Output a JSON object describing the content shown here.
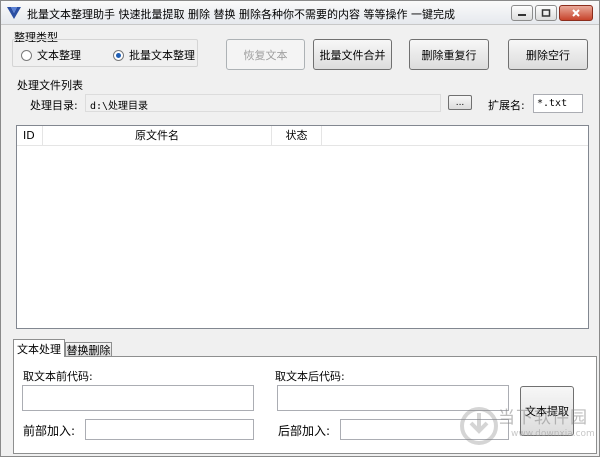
{
  "window": {
    "title": "批量文本整理助手   快速批量提取 删除 替换 删除各种你不需要的内容 等等操作 一键完成"
  },
  "organize_type": {
    "label": "整理类型",
    "options": [
      {
        "label": "文本整理",
        "selected": false
      },
      {
        "label": "批量文本整理",
        "selected": true
      }
    ]
  },
  "toolbar": {
    "restore_label": "恢复文本",
    "merge_label": "批量文件合并",
    "dedupe_label": "删除重复行",
    "delete_empty_label": "删除空行"
  },
  "file_list": {
    "group_label": "处理文件列表",
    "dir_label": "处理目录:",
    "dir_value": "d:\\处理目录",
    "browse_label": "...",
    "ext_label": "扩展名:",
    "ext_value": "*.txt",
    "columns": [
      "ID",
      "原文件名",
      "状态"
    ],
    "rows": []
  },
  "tabs": [
    {
      "label": "文本处理",
      "active": true
    },
    {
      "label": "替换删除",
      "active": false
    }
  ],
  "panel": {
    "before_code_label": "取文本前代码:",
    "after_code_label": "取文本后代码:",
    "prefix_label": "前部加入:",
    "suffix_label": "后部加入:",
    "extract_label": "文本提取"
  },
  "watermark": {
    "text": "当下软件园",
    "sub": "www.downxia.com"
  },
  "colors": {
    "window_bg": "#f0f0f0",
    "close_button": "#c7432b",
    "radio_selected": "#1f5fb5"
  }
}
